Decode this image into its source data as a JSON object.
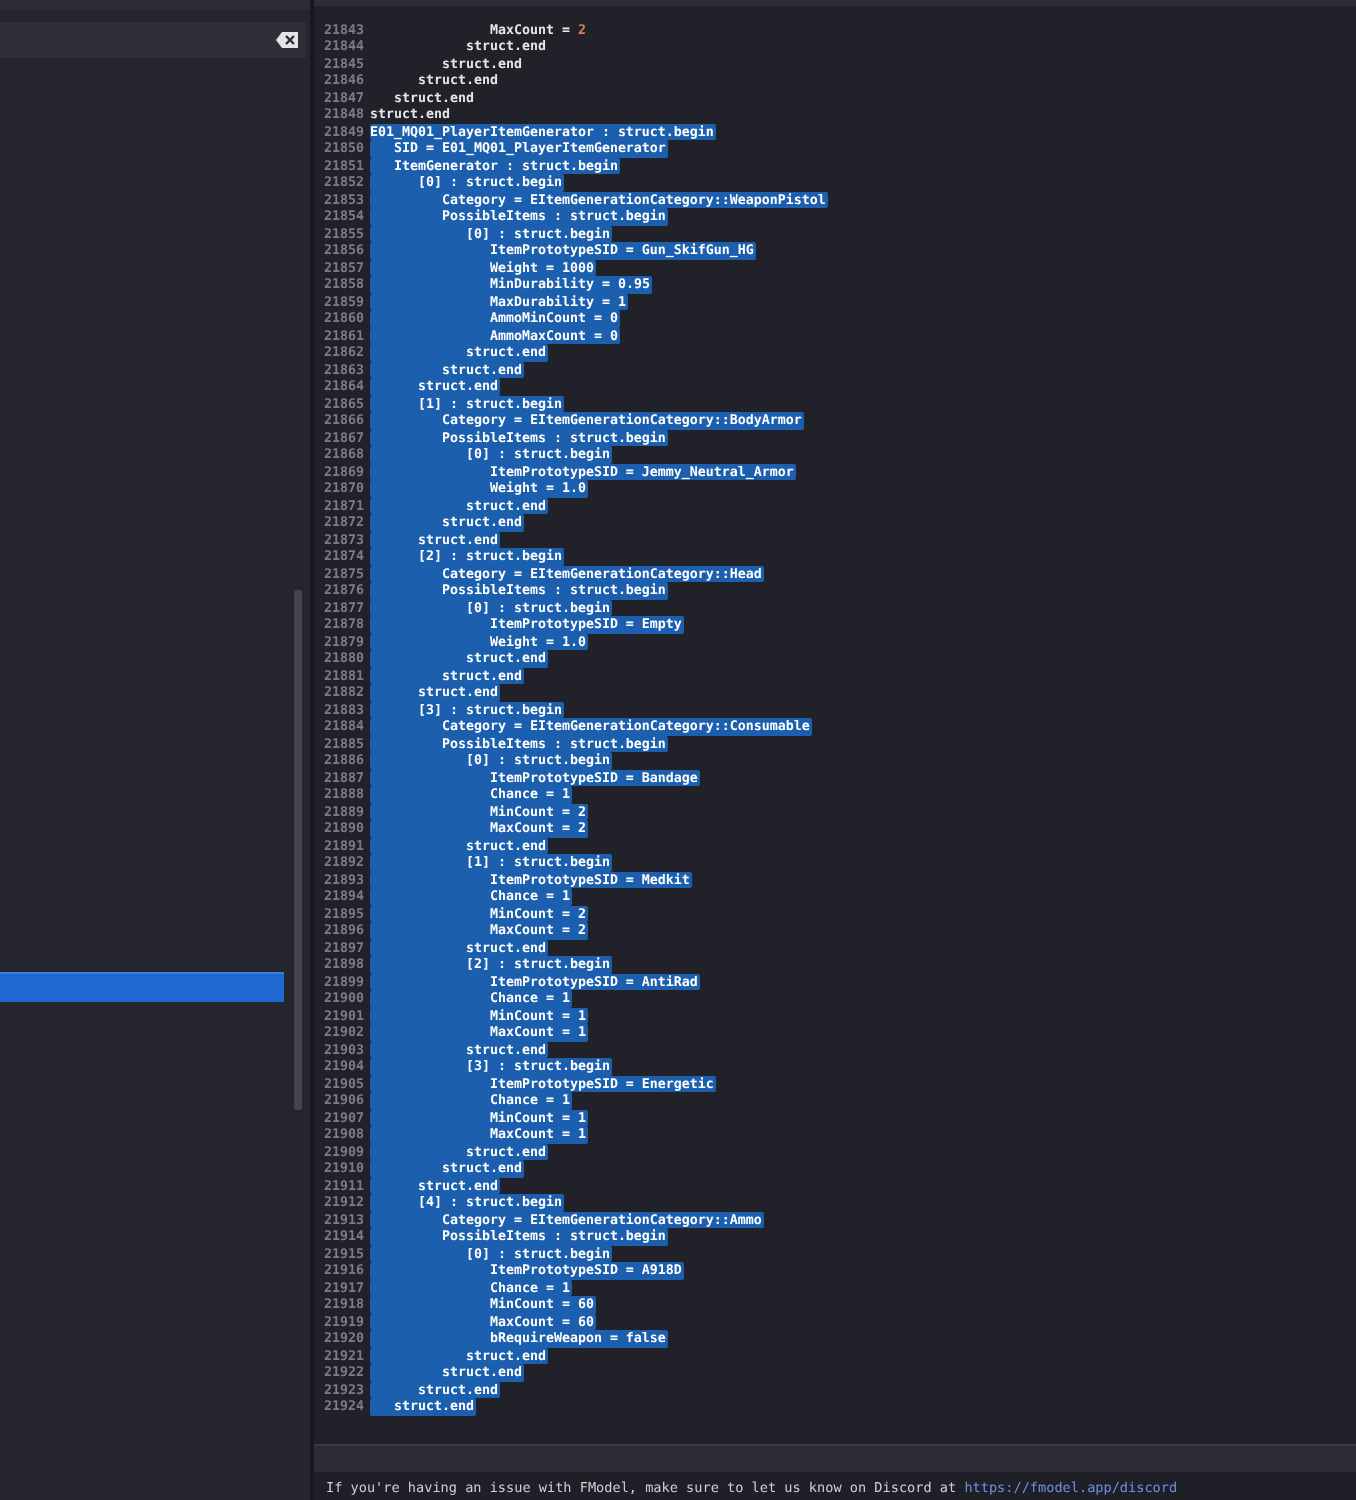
{
  "sidebar": {
    "items": [
      {
        "selected": true
      }
    ]
  },
  "editor": {
    "lines": [
      {
        "number": "21843",
        "code": "               MaxCount = ",
        "literal": "2",
        "selected": false
      },
      {
        "number": "21844",
        "code": "            struct.end",
        "selected": false
      },
      {
        "number": "21845",
        "code": "         struct.end",
        "selected": false
      },
      {
        "number": "21846",
        "code": "      struct.end",
        "selected": false
      },
      {
        "number": "21847",
        "code": "   struct.end",
        "selected": false
      },
      {
        "number": "21848",
        "code": "struct.end",
        "selected": false
      },
      {
        "number": "21849",
        "code": "E01_MQ01_PlayerItemGenerator : struct.begin",
        "selected": true
      },
      {
        "number": "21850",
        "code": "   SID = E01_MQ01_PlayerItemGenerator",
        "selected": true
      },
      {
        "number": "21851",
        "code": "   ItemGenerator : struct.begin",
        "selected": true
      },
      {
        "number": "21852",
        "code": "      [0] : struct.begin",
        "selected": true
      },
      {
        "number": "21853",
        "code": "         Category = EItemGenerationCategory::WeaponPistol",
        "selected": true
      },
      {
        "number": "21854",
        "code": "         PossibleItems : struct.begin",
        "selected": true
      },
      {
        "number": "21855",
        "code": "            [0] : struct.begin",
        "selected": true
      },
      {
        "number": "21856",
        "code": "               ItemPrototypeSID = Gun_SkifGun_HG",
        "selected": true
      },
      {
        "number": "21857",
        "code": "               Weight = ",
        "literal": "1000",
        "selected": true
      },
      {
        "number": "21858",
        "code": "               MinDurability = ",
        "literal": "0.95",
        "selected": true
      },
      {
        "number": "21859",
        "code": "               MaxDurability = ",
        "literal": "1",
        "selected": true
      },
      {
        "number": "21860",
        "code": "               AmmoMinCount = ",
        "literal": "0",
        "selected": true
      },
      {
        "number": "21861",
        "code": "               AmmoMaxCount = ",
        "literal": "0",
        "selected": true
      },
      {
        "number": "21862",
        "code": "            struct.end",
        "selected": true
      },
      {
        "number": "21863",
        "code": "         struct.end",
        "selected": true
      },
      {
        "number": "21864",
        "code": "      struct.end",
        "selected": true
      },
      {
        "number": "21865",
        "code": "      [1] : struct.begin",
        "selected": true
      },
      {
        "number": "21866",
        "code": "         Category = EItemGenerationCategory::BodyArmor",
        "selected": true
      },
      {
        "number": "21867",
        "code": "         PossibleItems : struct.begin",
        "selected": true
      },
      {
        "number": "21868",
        "code": "            [0] : struct.begin",
        "selected": true
      },
      {
        "number": "21869",
        "code": "               ItemPrototypeSID = Jemmy_Neutral_Armor",
        "selected": true
      },
      {
        "number": "21870",
        "code": "               Weight = ",
        "literal": "1.0",
        "selected": true
      },
      {
        "number": "21871",
        "code": "            struct.end",
        "selected": true
      },
      {
        "number": "21872",
        "code": "         struct.end",
        "selected": true
      },
      {
        "number": "21873",
        "code": "      struct.end",
        "selected": true
      },
      {
        "number": "21874",
        "code": "      [2] : struct.begin",
        "selected": true
      },
      {
        "number": "21875",
        "code": "         Category = EItemGenerationCategory::Head",
        "selected": true
      },
      {
        "number": "21876",
        "code": "         PossibleItems : struct.begin",
        "selected": true
      },
      {
        "number": "21877",
        "code": "            [0] : struct.begin",
        "selected": true
      },
      {
        "number": "21878",
        "code": "               ItemPrototypeSID = Empty",
        "selected": true
      },
      {
        "number": "21879",
        "code": "               Weight = ",
        "literal": "1.0",
        "selected": true
      },
      {
        "number": "21880",
        "code": "            struct.end",
        "selected": true
      },
      {
        "number": "21881",
        "code": "         struct.end",
        "selected": true
      },
      {
        "number": "21882",
        "code": "      struct.end",
        "selected": true
      },
      {
        "number": "21883",
        "code": "      [3] : struct.begin",
        "selected": true
      },
      {
        "number": "21884",
        "code": "         Category = EItemGenerationCategory::Consumable",
        "selected": true
      },
      {
        "number": "21885",
        "code": "         PossibleItems : struct.begin",
        "selected": true
      },
      {
        "number": "21886",
        "code": "            [0] : struct.begin",
        "selected": true
      },
      {
        "number": "21887",
        "code": "               ItemPrototypeSID = Bandage",
        "selected": true
      },
      {
        "number": "21888",
        "code": "               Chance = ",
        "literal": "1",
        "selected": true
      },
      {
        "number": "21889",
        "code": "               MinCount = ",
        "literal": "2",
        "selected": true
      },
      {
        "number": "21890",
        "code": "               MaxCount = ",
        "literal": "2",
        "selected": true
      },
      {
        "number": "21891",
        "code": "            struct.end",
        "selected": true
      },
      {
        "number": "21892",
        "code": "            [1] : struct.begin",
        "selected": true
      },
      {
        "number": "21893",
        "code": "               ItemPrototypeSID = Medkit",
        "selected": true
      },
      {
        "number": "21894",
        "code": "               Chance = ",
        "literal": "1",
        "selected": true
      },
      {
        "number": "21895",
        "code": "               MinCount = ",
        "literal": "2",
        "selected": true
      },
      {
        "number": "21896",
        "code": "               MaxCount = ",
        "literal": "2",
        "selected": true
      },
      {
        "number": "21897",
        "code": "            struct.end",
        "selected": true
      },
      {
        "number": "21898",
        "code": "            [2] : struct.begin",
        "selected": true
      },
      {
        "number": "21899",
        "code": "               ItemPrototypeSID = AntiRad",
        "selected": true
      },
      {
        "number": "21900",
        "code": "               Chance = ",
        "literal": "1",
        "selected": true
      },
      {
        "number": "21901",
        "code": "               MinCount = ",
        "literal": "1",
        "selected": true
      },
      {
        "number": "21902",
        "code": "               MaxCount = ",
        "literal": "1",
        "selected": true
      },
      {
        "number": "21903",
        "code": "            struct.end",
        "selected": true
      },
      {
        "number": "21904",
        "code": "            [3] : struct.begin",
        "selected": true
      },
      {
        "number": "21905",
        "code": "               ItemPrototypeSID = Energetic",
        "selected": true
      },
      {
        "number": "21906",
        "code": "               Chance = ",
        "literal": "1",
        "selected": true
      },
      {
        "number": "21907",
        "code": "               MinCount = ",
        "literal": "1",
        "selected": true
      },
      {
        "number": "21908",
        "code": "               MaxCount = ",
        "literal": "1",
        "selected": true
      },
      {
        "number": "21909",
        "code": "            struct.end",
        "selected": true
      },
      {
        "number": "21910",
        "code": "         struct.end",
        "selected": true
      },
      {
        "number": "21911",
        "code": "      struct.end",
        "selected": true
      },
      {
        "number": "21912",
        "code": "      [4] : struct.begin",
        "selected": true
      },
      {
        "number": "21913",
        "code": "         Category = EItemGenerationCategory::Ammo",
        "selected": true
      },
      {
        "number": "21914",
        "code": "         PossibleItems : struct.begin",
        "selected": true
      },
      {
        "number": "21915",
        "code": "            [0] : struct.begin",
        "selected": true
      },
      {
        "number": "21916",
        "code": "               ItemPrototypeSID = A918D",
        "selected": true
      },
      {
        "number": "21917",
        "code": "               Chance = ",
        "literal": "1",
        "selected": true
      },
      {
        "number": "21918",
        "code": "               MinCount = ",
        "literal": "60",
        "selected": true
      },
      {
        "number": "21919",
        "code": "               MaxCount = ",
        "literal": "60",
        "selected": true
      },
      {
        "number": "21920",
        "code": "               bRequireWeapon = false",
        "selected": true
      },
      {
        "number": "21921",
        "code": "            struct.end",
        "selected": true
      },
      {
        "number": "21922",
        "code": "         struct.end",
        "selected": true
      },
      {
        "number": "21923",
        "code": "      struct.end",
        "selected": true
      },
      {
        "number": "21924",
        "code": "   struct.end",
        "selected": true
      }
    ]
  },
  "log": {
    "message": "If you're having an issue with FModel, make sure to let us know on Discord at ",
    "link": "https://fmodel.app/discord"
  }
}
